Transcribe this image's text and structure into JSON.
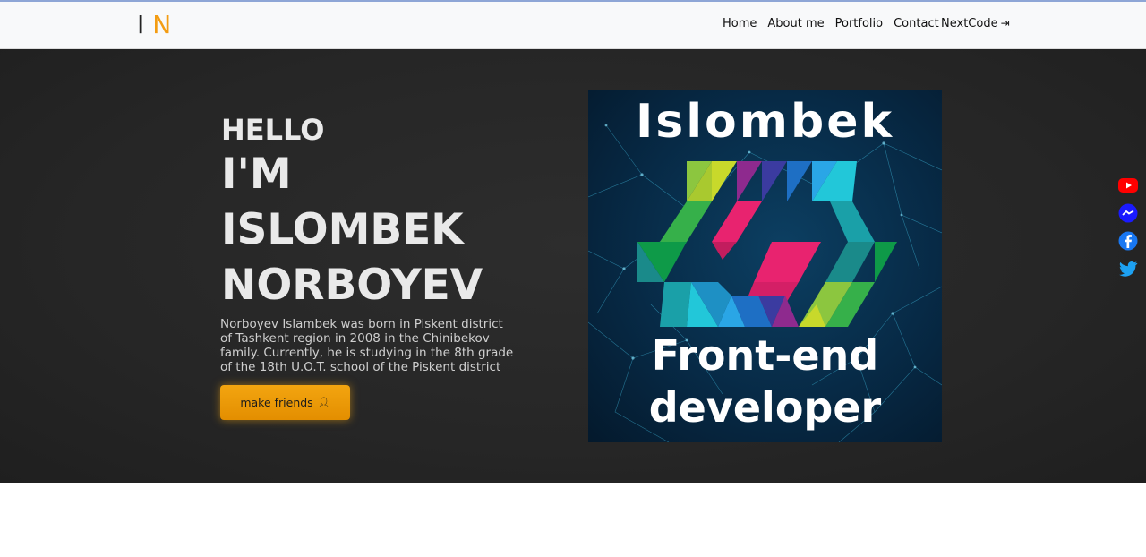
{
  "brand": {
    "letter1": "I",
    "letter2": "N"
  },
  "nav": {
    "items": [
      "Home",
      "About me",
      "Portfolio",
      "Contact"
    ],
    "cta": "NextCode",
    "cta_icon": "sign-in-arrow-icon"
  },
  "hero": {
    "hello": "HELLO",
    "name_lines": [
      "I'M",
      "ISLOMBEK",
      "NORBOYEV"
    ],
    "bio": "Norboyev Islambek was born in Piskent district of Tashkent region in 2008 in the Chinibekov family. Currently, he is studying in the 8th grade of the 18th U.O.T. school of the Piskent district",
    "button": "make friends",
    "button_icon": "person-icon"
  },
  "poster": {
    "top_text": "Islombek",
    "bottom_line1": "Front-end",
    "bottom_line2": "developer"
  },
  "social": [
    "youtube-icon",
    "messenger-icon",
    "facebook-icon",
    "twitter-icon"
  ],
  "colors": {
    "accent": "#f39c12",
    "button": "#e99a06",
    "hero_bg": "#262626",
    "youtube": "#ff0000",
    "messenger": "#1a1aff",
    "facebook": "#1877f2",
    "twitter": "#1da1f2"
  }
}
